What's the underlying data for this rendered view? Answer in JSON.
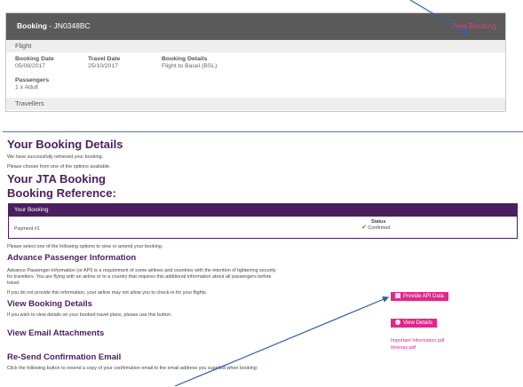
{
  "top": {
    "booking_label": "Booking",
    "booking_ref": " - JN0348BC",
    "view_booking": "View Booking",
    "flight": "Flight",
    "booking_date_label": "Booking Date",
    "booking_date": "05/08/2017",
    "travel_date_label": "Travel Date",
    "travel_date": "25/10/2017",
    "booking_details_label": "Booking Details",
    "booking_details": "Flight to Basel (BSL)",
    "passengers_label": "Passengers",
    "passengers": "1 x Adult",
    "travellers": "Travellers"
  },
  "main": {
    "title": "Your Booking Details",
    "retrieved": "We have successfully retrieved your booking.",
    "choose": "Please choose from one of the options available.",
    "jta_title": "Your JTA Booking",
    "ref_title": "Booking Reference:",
    "card_title": "Your Booking",
    "payment": "Payment #1",
    "status_label": "Status",
    "status_value": "Confirmed",
    "select_text": "Please select one of the following options to view or amend your booking.",
    "api_title": "Advance Passenger Information",
    "api_desc1": "Advance Passenger Information (or API) is a requirement of some airlines and countries with the intention of tightening security",
    "api_desc2": "for travellers. You are flying with an airline or to a country that requires this additional information about all passengers before",
    "api_desc3": "travel.",
    "api_warn": "If you do not provide this information, your airline may not allow you to check-in for your flights.",
    "provide_api": "Provide API Data",
    "view_details_title": "View Booking Details",
    "view_details_desc": "If you wish to view details on your booked travel plans, please use this button.",
    "view_details_btn": "View Details",
    "attachments_title": "View Email Attachments",
    "attachment1": "Important Information.pdf",
    "attachment2": "Itinerary.pdf",
    "resend_title": "Re-Send Confirmation Email",
    "resend_desc": "Click the following button to resend a copy of your confirmation email to the email address you supplied when booking:"
  },
  "colors": {
    "header_bg": "#5a5a5a",
    "accent_pink": "#e0288a",
    "purple": "#4b1e5e",
    "arrow_blue": "#2f5fb3"
  }
}
